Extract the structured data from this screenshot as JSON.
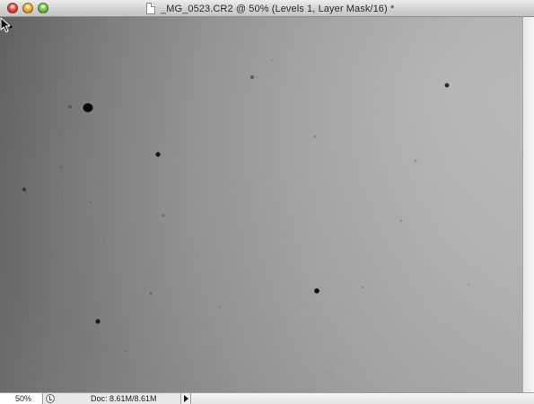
{
  "window": {
    "title": "_MG_0523.CR2 @ 50% (Levels 1, Layer Mask/16) *"
  },
  "status_bar": {
    "zoom": "50%",
    "doc_info": "Doc: 8.61M/8.61M"
  },
  "icons": {
    "close": "close-button-icon",
    "minimize": "minimize-button-icon",
    "zoom": "zoom-button-icon",
    "document": "document-icon",
    "cursor": "arrow-cursor-icon",
    "status": "status-indicator-icon",
    "menu_arrow": "right-triangle-icon"
  }
}
